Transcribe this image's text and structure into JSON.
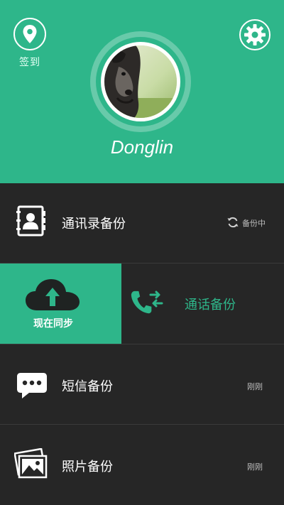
{
  "header": {
    "checkin_label": "签到",
    "username": "Donglin"
  },
  "rows": {
    "contacts": {
      "label": "通讯录备份",
      "status": "备份中"
    },
    "sync": {
      "label": "现在同步"
    },
    "calls": {
      "label": "通话备份"
    },
    "sms": {
      "label": "短信备份",
      "status": "刚刚"
    },
    "photos": {
      "label": "照片备份",
      "status": "刚刚"
    }
  },
  "colors": {
    "accent": "#2eb68a",
    "background": "#262626"
  },
  "icons": {
    "checkin": "location-pin-icon",
    "settings": "gear-icon",
    "contacts": "contact-book-icon",
    "syncing": "refresh-icon",
    "sync": "cloud-upload-icon",
    "calls": "phone-transfer-icon",
    "sms": "chat-bubble-icon",
    "photos": "photo-icon"
  }
}
